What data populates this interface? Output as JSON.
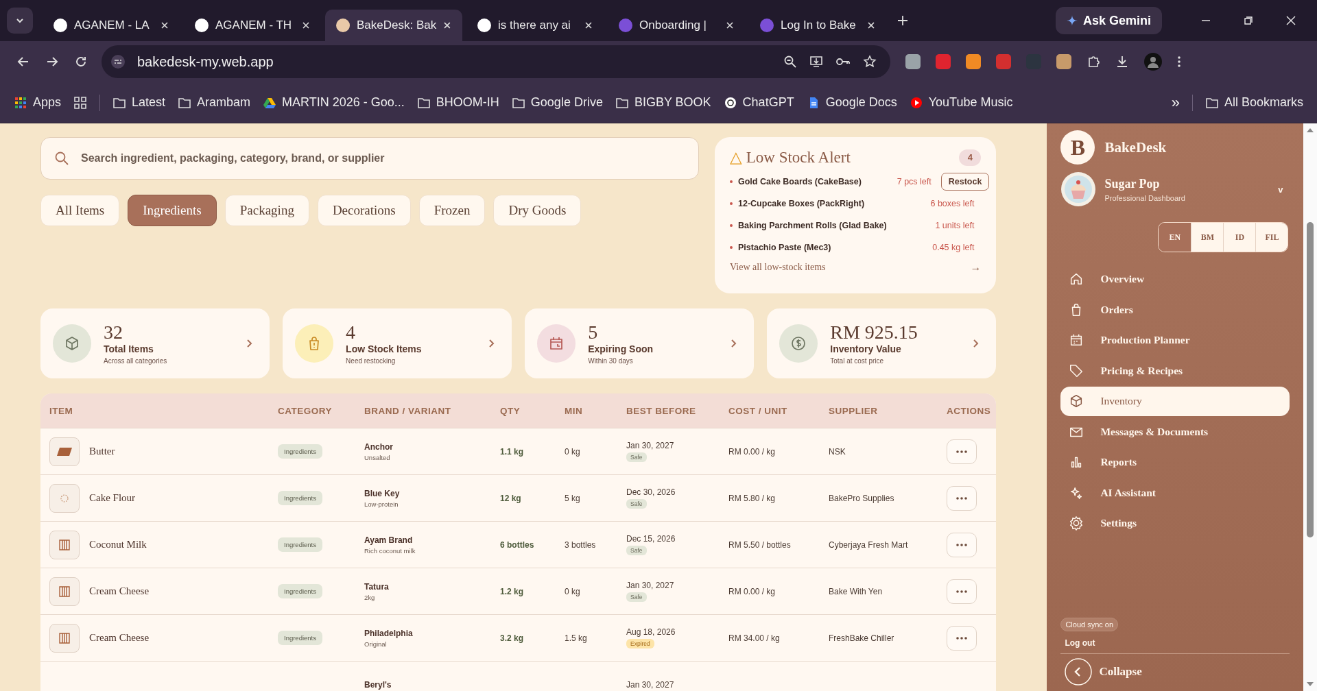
{
  "browser": {
    "tabs": [
      {
        "title": "AGANEM - LA",
        "selected": false
      },
      {
        "title": "AGANEM - TH",
        "selected": false
      },
      {
        "title": "BakeDesk: Bak",
        "selected": true
      },
      {
        "title": "is there any ai",
        "selected": false
      },
      {
        "title": "Onboarding |",
        "selected": false
      },
      {
        "title": "Log In to Bake",
        "selected": false
      }
    ],
    "gemini": "Ask Gemini",
    "url": "bakedesk-my.web.app",
    "bookmarks": [
      {
        "label": "Apps",
        "kind": "apps"
      },
      {
        "label": "Latest",
        "kind": "folder"
      },
      {
        "label": "Arambam",
        "kind": "folder"
      },
      {
        "label": "MARTIN 2026 - Goo...",
        "kind": "drive"
      },
      {
        "label": "BHOOM-IH",
        "kind": "folder"
      },
      {
        "label": "Google Drive",
        "kind": "folder"
      },
      {
        "label": "BIGBY BOOK",
        "kind": "folder"
      },
      {
        "label": "ChatGPT",
        "kind": "chat"
      },
      {
        "label": "Google Docs",
        "kind": "docs"
      },
      {
        "label": "YouTube Music",
        "kind": "music"
      }
    ],
    "more": "»",
    "all_bookmarks": "All Bookmarks"
  },
  "search": {
    "placeholder": "Search ingredient, packaging, category, brand, or supplier"
  },
  "filters": [
    {
      "label": "All Items",
      "selected": false
    },
    {
      "label": "Ingredients",
      "selected": true
    },
    {
      "label": "Packaging",
      "selected": false
    },
    {
      "label": "Decorations",
      "selected": false
    },
    {
      "label": "Frozen",
      "selected": false
    },
    {
      "label": "Dry Goods",
      "selected": false
    }
  ],
  "low_stock": {
    "icon": "△",
    "title": "Low Stock Alert",
    "count": "4",
    "items": [
      {
        "name": "Gold Cake Boards (CakeBase)",
        "left": "7 pcs left",
        "action": "Restock"
      },
      {
        "name": "12-Cupcake Boxes (PackRight)",
        "left": "6 boxes left"
      },
      {
        "name": "Baking Parchment Rolls (Glad Bake)",
        "left": "1 units left"
      },
      {
        "name": "Pistachio Paste (Mec3)",
        "left": "0.45 kg left"
      }
    ],
    "link": "View all low-stock items",
    "arrow": "→"
  },
  "stats": [
    {
      "value": "32",
      "label": "Total Items",
      "sub": "Across all categories",
      "color": "#e3e6d8"
    },
    {
      "value": "4",
      "label": "Low Stock Items",
      "sub": "Need restocking",
      "color": "#fcefb8"
    },
    {
      "value": "5",
      "label": "Expiring Soon",
      "sub": "Within 30 days",
      "color": "#f3dde0"
    },
    {
      "value": "RM 925.15",
      "label": "Inventory Value",
      "sub": "Total at cost price",
      "color": "#e3e6d8"
    }
  ],
  "table": {
    "columns": [
      "ITEM",
      "CATEGORY",
      "BRAND / VARIANT",
      "QTY",
      "MIN",
      "BEST BEFORE",
      "COST / UNIT",
      "SUPPLIER",
      "ACTIONS"
    ],
    "rows": [
      {
        "item": "Butter",
        "category": "Ingredients",
        "brand": "Anchor",
        "variant": "Unsalted",
        "qty": "1.1 kg",
        "min": "0 kg",
        "best_before": "Jan 30, 2027",
        "status": {
          "label": "Safe",
          "kind": "safe"
        },
        "cost": "RM 0.00 / kg",
        "supplier": "NSK"
      },
      {
        "item": "Cake Flour",
        "category": "Ingredients",
        "brand": "Blue Key",
        "variant": "Low-protein",
        "qty": "12 kg",
        "min": "5 kg",
        "best_before": "Dec 30, 2026",
        "status": {
          "label": "Safe",
          "kind": "safe"
        },
        "cost": "RM 5.80 / kg",
        "supplier": "BakePro Supplies"
      },
      {
        "item": "Coconut Milk",
        "category": "Ingredients",
        "brand": "Ayam Brand",
        "variant": "Rich coconut milk",
        "qty": "6 bottles",
        "min": "3 bottles",
        "best_before": "Dec 15, 2026",
        "status": {
          "label": "Safe",
          "kind": "safe"
        },
        "cost": "RM 5.50 / bottles",
        "supplier": "Cyberjaya Fresh Mart"
      },
      {
        "item": "Cream Cheese",
        "category": "Ingredients",
        "brand": "Tatura",
        "variant": "2kg",
        "qty": "1.2 kg",
        "min": "0 kg",
        "best_before": "Jan 30, 2027",
        "status": {
          "label": "Safe",
          "kind": "safe"
        },
        "cost": "RM 0.00 / kg",
        "supplier": "Bake With Yen"
      },
      {
        "item": "Cream Cheese",
        "category": "Ingredients",
        "brand": "Philadelphia",
        "variant": "Original",
        "qty": "3.2 kg",
        "min": "1.5 kg",
        "best_before": "Aug 18, 2026",
        "status": {
          "label": "Expired",
          "kind": "expired"
        },
        "cost": "RM 34.00 / kg",
        "supplier": "FreshBake Chiller"
      },
      {
        "brand": "Beryl's",
        "best_before": "Jan 30, 2027"
      }
    ]
  },
  "sidebar": {
    "logo": "B",
    "brand": "BakeDesk",
    "shop": "Sugar Pop",
    "shop_sub": "Professional Dashboard",
    "caret": "v",
    "languages": [
      {
        "label": "EN",
        "selected": true
      },
      {
        "label": "BM",
        "selected": false
      },
      {
        "label": "ID",
        "selected": false
      },
      {
        "label": "FIL",
        "selected": false
      }
    ],
    "nav": [
      {
        "label": "Overview",
        "selected": false
      },
      {
        "label": "Orders",
        "selected": false
      },
      {
        "label": "Production Planner",
        "selected": false
      },
      {
        "label": "Pricing & Recipes",
        "selected": false
      },
      {
        "label": "Inventory",
        "selected": true
      },
      {
        "label": "Messages & Documents",
        "selected": false
      },
      {
        "label": "Reports",
        "selected": false
      },
      {
        "label": "AI Assistant",
        "selected": false
      },
      {
        "label": "Settings",
        "selected": false
      }
    ],
    "sync": "Cloud sync on",
    "logout": "Log out",
    "collapse": "Collapse"
  }
}
